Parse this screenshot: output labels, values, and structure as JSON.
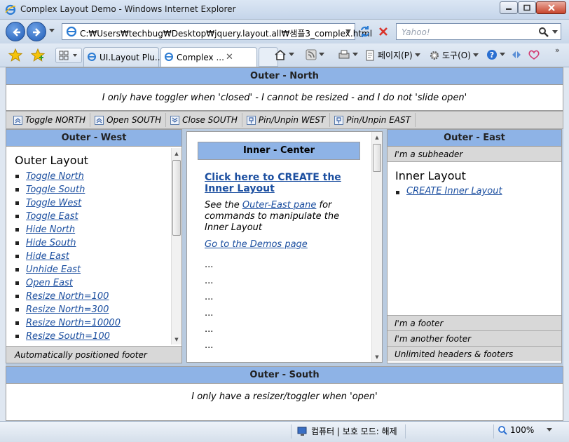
{
  "window": {
    "title": "Complex Layout Demo - Windows Internet Explorer"
  },
  "address_bar": {
    "url": "C:₩Users₩techbug₩Desktop₩jquery.layout.all₩샘플3_complex.html"
  },
  "search": {
    "placeholder": "Yahoo!"
  },
  "tabs": [
    {
      "label": "UI.Layout Plu..."
    },
    {
      "label": "Complex ..."
    }
  ],
  "commands": {
    "page": "페이지(P)",
    "tools": "도구(O)"
  },
  "layout": {
    "north": {
      "header": "Outer - North",
      "text": "I only have toggler when 'closed' - I cannot be resized - and I do not 'slide open'"
    },
    "toolbar": [
      {
        "label": "Toggle NORTH",
        "icon": "chevron-up"
      },
      {
        "label": "Open SOUTH",
        "icon": "chevron-up"
      },
      {
        "label": "Close SOUTH",
        "icon": "chevron-down"
      },
      {
        "label": "Pin/Unpin WEST",
        "icon": "pin"
      },
      {
        "label": "Pin/Unpin EAST",
        "icon": "pin"
      }
    ],
    "west": {
      "header": "Outer - West",
      "title": "Outer Layout",
      "links": [
        "Toggle North",
        "Toggle South",
        "Toggle West",
        "Toggle East",
        "Hide North",
        "Hide South",
        "Hide East",
        "Unhide East",
        "Open East",
        "Resize North=100",
        "Resize North=300",
        "Resize North=10000",
        "Resize South=100"
      ],
      "footer": "Automatically positioned footer"
    },
    "center": {
      "header": "Inner - Center",
      "create_link": "Click here to CREATE the Inner Layout",
      "see_prefix": "See the ",
      "see_link": "Outer-East pane",
      "see_suffix": " for commands to manipulate the Inner Layout",
      "demos_link": "Go to the Demos page",
      "dots": [
        "...",
        "...",
        "...",
        "...",
        "...",
        "...",
        "..."
      ]
    },
    "east": {
      "header": "Outer - East",
      "subheader": "I'm a subheader",
      "title": "Inner Layout",
      "link": "CREATE Inner Layout",
      "footers": [
        "I'm a footer",
        "I'm another footer",
        "Unlimited headers & footers"
      ]
    },
    "south": {
      "header": "Outer - South",
      "text": "I only have a resizer/toggler when 'open'"
    }
  },
  "status": {
    "zone": "컴퓨터 | 보호 모드: 해제",
    "zoom": "100%"
  },
  "colors": {
    "pane_header": "#8eb3e6",
    "link": "#1c4fa0",
    "bar_gray": "#d8d8d8"
  }
}
